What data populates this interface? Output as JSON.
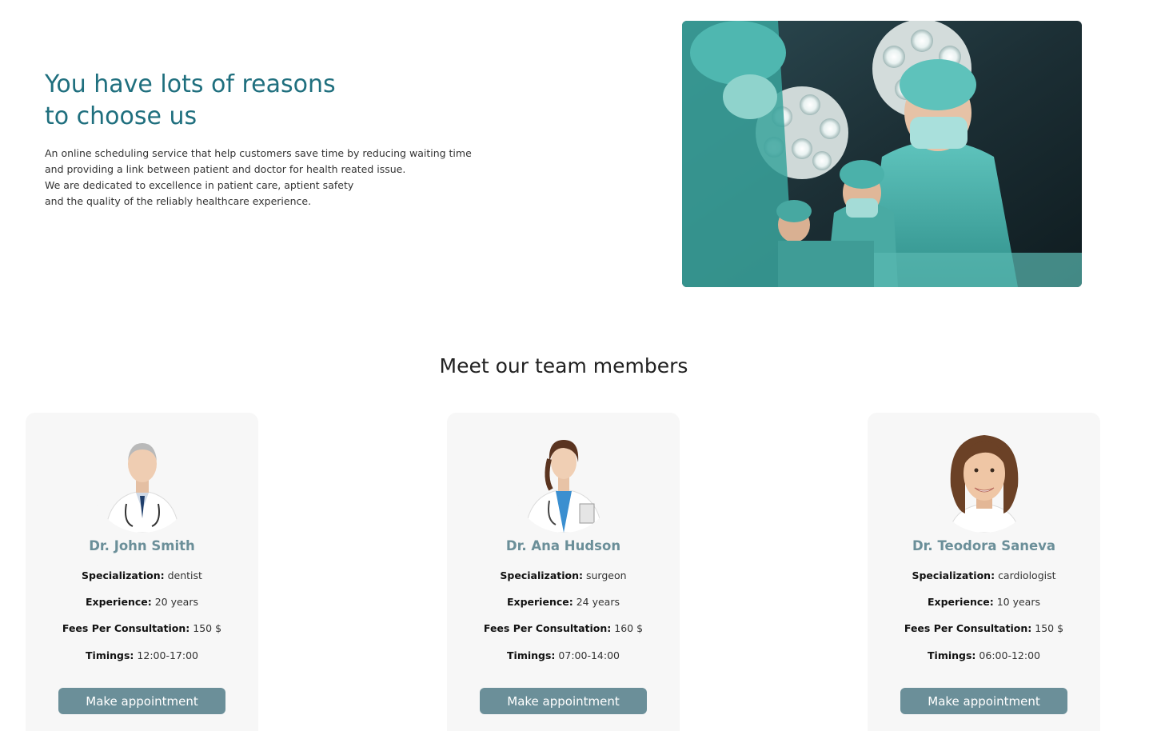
{
  "hero": {
    "title_line1": "You have lots of reasons",
    "title_line2": "to choose us",
    "text_lines": [
      "An online scheduling service that help customers save time by reducing waiting time",
      "and providing a link between patient and doctor for health reated issue.",
      "We are dedicated to excellence in patient care, aptient safety",
      "and the quality of the reliably healthcare experience."
    ]
  },
  "team": {
    "heading": "Meet our team members",
    "labels": {
      "specialization": "Specialization:",
      "experience": "Experience:",
      "fees": "Fees Per Consultation:",
      "timings": "Timings:"
    },
    "button_label": "Make appointment",
    "doctors": [
      {
        "name": "Dr. John Smith",
        "specialization": "dentist",
        "experience": "20 years",
        "fees": "150 $",
        "timings": "12:00-17:00"
      },
      {
        "name": "Dr. Ana Hudson",
        "specialization": "surgeon",
        "experience": "24 years",
        "fees": "160 $",
        "timings": "07:00-14:00"
      },
      {
        "name": "Dr. Teodora Saneva",
        "specialization": "cardiologist",
        "experience": "10 years",
        "fees": "150 $",
        "timings": "06:00-12:00"
      }
    ]
  },
  "colors": {
    "accent": "#1f6f7e",
    "button": "#6b8f99",
    "card_bg": "#f7f7f7"
  }
}
